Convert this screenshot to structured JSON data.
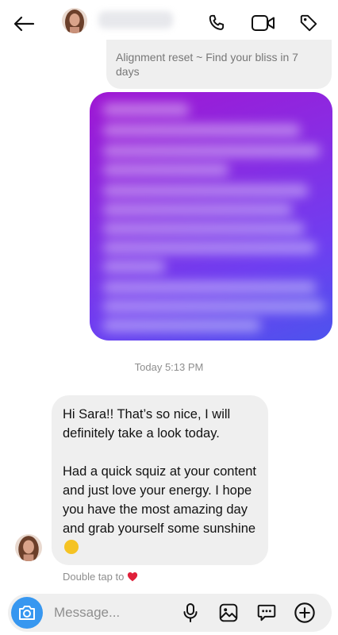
{
  "thread": {
    "previous_message": "Alignment reset ~ Find your bliss in 7 days",
    "timestamp": "Today 5:13 PM",
    "reply_message": "Hi Sara!! That’s so nice, I will definitely take a look today.\n\nHad a quick squiz at your content and just love your energy. I hope you have the most amazing day and grab yourself some sunshine",
    "reply_emoji": "hugging-face",
    "double_tap_hint": "Double tap to"
  },
  "composer": {
    "placeholder": "Message..."
  },
  "colors": {
    "accent_blue": "#3797f0",
    "heart_red": "#e0203a",
    "bubble_gray": "#efefef",
    "media_gradient_start": "#9f17d3",
    "media_gradient_end": "#4d53ee"
  },
  "icons": {
    "header": [
      "back-arrow-icon",
      "phone-icon",
      "video-camera-icon",
      "tag-icon"
    ],
    "composer": [
      "camera-icon",
      "microphone-icon",
      "gallery-icon",
      "sticker-icon",
      "plus-icon"
    ]
  }
}
